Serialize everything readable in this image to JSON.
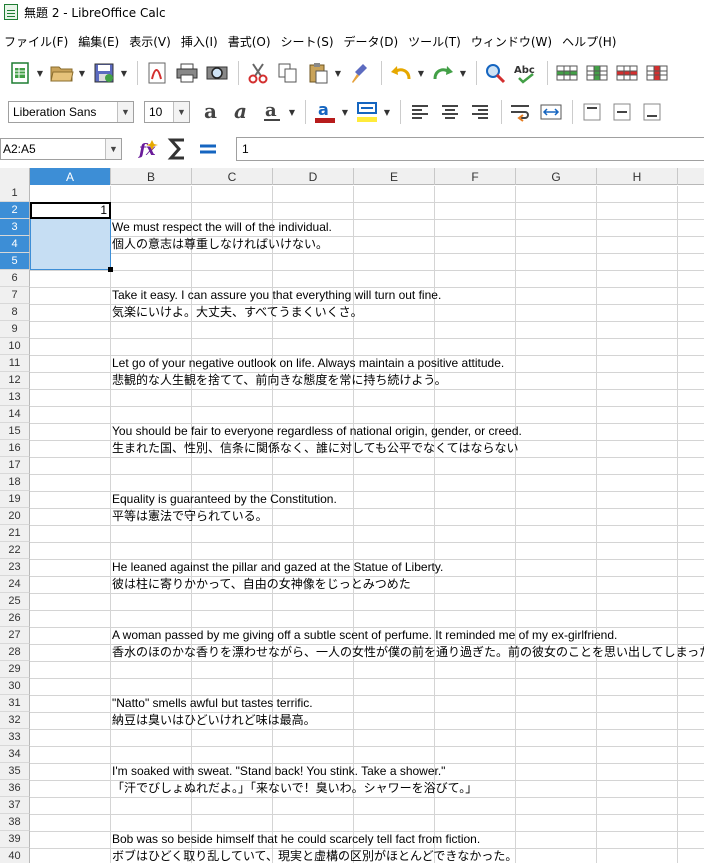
{
  "window": {
    "title": "無題 2 - LibreOffice Calc"
  },
  "menu": [
    "ファイル(F)",
    "編集(E)",
    "表示(V)",
    "挿入(I)",
    "書式(O)",
    "シート(S)",
    "データ(D)",
    "ツール(T)",
    "ウィンドウ(W)",
    "ヘルプ(H)"
  ],
  "font": {
    "name": "Liberation Sans",
    "size": "10"
  },
  "formula_bar": {
    "name_box": "A2:A5",
    "content": "1"
  },
  "columns": [
    "A",
    "B",
    "C",
    "D",
    "E",
    "F",
    "G",
    "H"
  ],
  "rows": [
    "1",
    "2",
    "3",
    "4",
    "5",
    "6",
    "7",
    "8",
    "9",
    "10",
    "11",
    "12",
    "13",
    "14",
    "15",
    "16",
    "17",
    "18",
    "19",
    "20",
    "21",
    "22",
    "23",
    "24",
    "25",
    "26",
    "27",
    "28",
    "29",
    "30",
    "31",
    "32",
    "33",
    "34",
    "35",
    "36",
    "37",
    "38",
    "39",
    "40"
  ],
  "active_cell_value": "1",
  "cells": [
    {
      "row": 3,
      "text": "We must respect the will of the individual."
    },
    {
      "row": 4,
      "text": "個人の意志は尊重しなければいけない。"
    },
    {
      "row": 7,
      "text": "Take it easy. I can assure you that everything will turn out fine."
    },
    {
      "row": 8,
      "text": "気楽にいけよ。大丈夫、すべてうまくいくさ。"
    },
    {
      "row": 11,
      "text": "Let go of your negative outlook on life. Always maintain a positive attitude."
    },
    {
      "row": 12,
      "text": "悲観的な人生観を捨てて、前向きな態度を常に持ち続けよう。"
    },
    {
      "row": 15,
      "text": "You should be fair to everyone regardless of national origin, gender, or creed."
    },
    {
      "row": 16,
      "text": "生まれた国、性別、信条に関係なく、誰に対しても公平でなくてはならない"
    },
    {
      "row": 19,
      "text": "Equality is guaranteed by the Constitution."
    },
    {
      "row": 20,
      "text": "平等は憲法で守られている。"
    },
    {
      "row": 23,
      "text": "He leaned against the pillar and gazed at the Statue of Liberty."
    },
    {
      "row": 24,
      "text": "彼は柱に寄りかかって、自由の女神像をじっとみつめた"
    },
    {
      "row": 27,
      "text": "A woman passed by me giving off a subtle scent of perfume. It reminded me of my ex-girlfriend."
    },
    {
      "row": 28,
      "text": "香水のほのかな香りを漂わせながら、一人の女性が僕の前を通り過ぎた。前の彼女のことを思い出してしまった。"
    },
    {
      "row": 31,
      "text": "\"Natto\" smells awful but tastes terrific."
    },
    {
      "row": 32,
      "text": "納豆は臭いはひどいけれど味は最高。"
    },
    {
      "row": 35,
      "text": "I'm soaked with sweat. \"Stand back! You stink. Take a shower.\""
    },
    {
      "row": 36,
      "text": "「汗でびしょぬれだよ。」「来ないで！臭いわ。シャワーを浴びて。」"
    },
    {
      "row": 39,
      "text": "Bob was so beside himself that he could scarcely tell fact from fiction."
    },
    {
      "row": 40,
      "text": "ボブはひどく取り乱していて、現実と虚構の区別がほとんどできなかった。"
    }
  ],
  "colors": {
    "selection": "#c6def3",
    "header_selected": "#3d8ed6",
    "accent_green": "#1e7d32"
  }
}
